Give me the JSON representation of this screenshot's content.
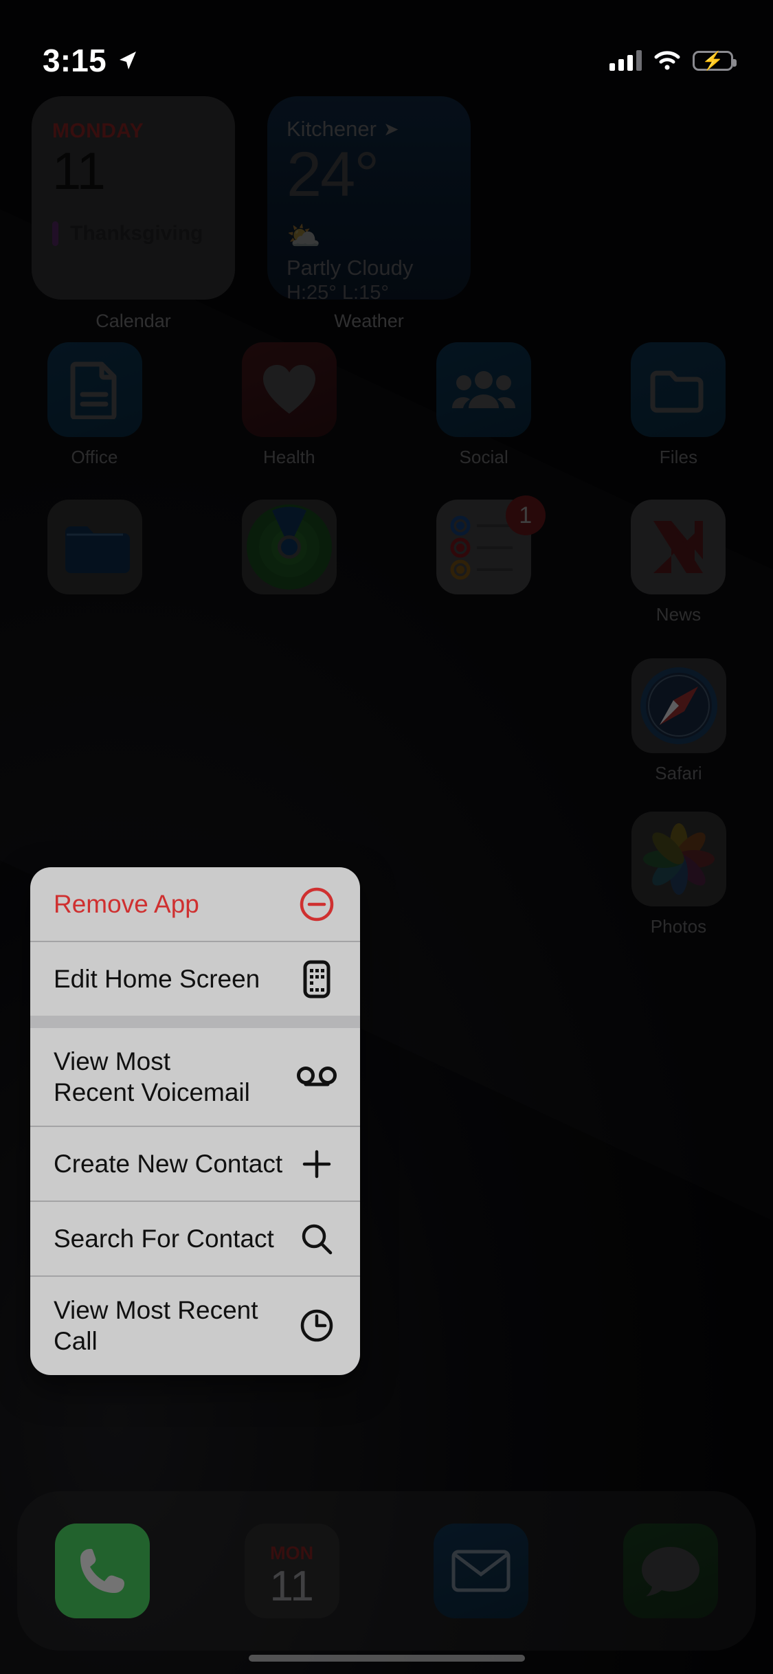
{
  "status_bar": {
    "time": "3:15",
    "location_icon": "location-arrow-icon",
    "signal_icon": "cellular-signal-icon",
    "wifi_icon": "wifi-icon",
    "battery_icon": "battery-charging-icon",
    "battery_bolt": "⚡"
  },
  "widgets": [
    {
      "name": "calendar-widget",
      "label": "Calendar",
      "weekday": "MONDAY",
      "date": "11",
      "event": "Thanksgiving"
    },
    {
      "name": "weather-widget",
      "label": "Weather",
      "city": "Kitchener",
      "location_icon": "location-arrow-icon",
      "temperature": "24°",
      "condition_icon": "⛅",
      "condition": "Partly Cloudy",
      "high_low": "H:25° L:15°"
    }
  ],
  "app_grid": {
    "row1": [
      {
        "name": "office",
        "label": "Office"
      },
      {
        "name": "health",
        "label": "Health"
      },
      {
        "name": "social",
        "label": "Social"
      },
      {
        "name": "files",
        "label": "Files"
      }
    ],
    "row2": [
      {
        "name": "folder",
        "label": ""
      },
      {
        "name": "find-my",
        "label": ""
      },
      {
        "name": "reminders",
        "label": "",
        "badge": "1"
      },
      {
        "name": "news",
        "label": "News"
      }
    ],
    "row3": [
      {
        "name": "safari",
        "label": "Safari"
      }
    ],
    "row4": [
      {
        "name": "photos",
        "label": "Photos"
      }
    ]
  },
  "dock": [
    {
      "name": "phone",
      "label": "phone-icon"
    },
    {
      "name": "calendar",
      "weekday": "MON",
      "date": "11"
    },
    {
      "name": "mail",
      "label": "mail-icon"
    },
    {
      "name": "messages",
      "label": "messages-icon"
    }
  ],
  "context_menu": {
    "items": [
      {
        "label": "Remove App",
        "icon": "minus-circle-icon",
        "destructive": true,
        "separator_after": "thin"
      },
      {
        "label": "Edit Home Screen",
        "icon": "edit-home-screen-icon",
        "destructive": false,
        "separator_after": "thick"
      },
      {
        "label": "View Most\nRecent Voicemail",
        "icon": "voicemail-icon",
        "destructive": false,
        "separator_after": "thin"
      },
      {
        "label": "Create New Contact",
        "icon": "plus-icon",
        "destructive": false,
        "separator_after": "thin"
      },
      {
        "label": "Search For Contact",
        "icon": "search-icon",
        "destructive": false,
        "separator_after": "thin"
      },
      {
        "label": "View Most Recent Call",
        "icon": "clock-icon",
        "destructive": false,
        "separator_after": "none"
      }
    ]
  },
  "colors": {
    "destructive": "#cf3030",
    "menu_background": "#cbcbcb",
    "accent_green": "#4cd964",
    "calendar_red": "#7b1f20"
  }
}
